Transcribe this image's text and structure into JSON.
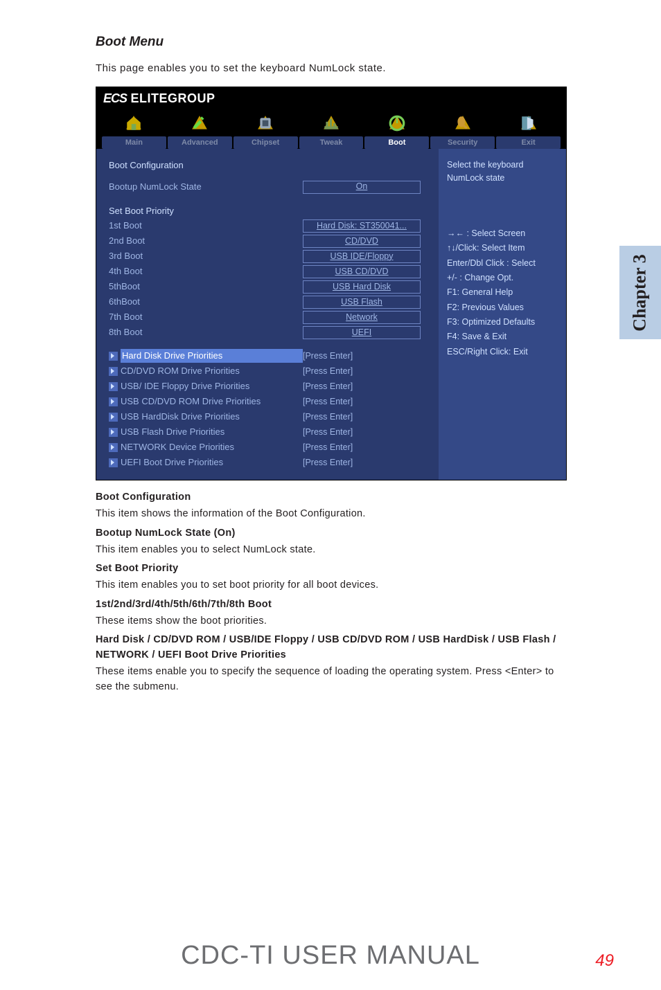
{
  "chapter_tab": "Chapter 3",
  "section": {
    "title": "Boot Menu",
    "intro": "This page enables you to set the keyboard NumLock state."
  },
  "bios": {
    "brand": "ELITEGROUP",
    "tabs": [
      "Main",
      "Advanced",
      "Chipset",
      "Tweak",
      "Boot",
      "Security",
      "Exit"
    ],
    "active_tab": "Boot",
    "left": {
      "boot_config_label": "Boot Configuration",
      "numlock_label": "Bootup NumLock State",
      "numlock_value": "On",
      "priority_header": "Set Boot Priority",
      "boots": [
        {
          "label": "1st Boot",
          "value": "Hard Disk: ST350041..."
        },
        {
          "label": "2nd Boot",
          "value": "CD/DVD"
        },
        {
          "label": "3rd Boot",
          "value": "USB IDE/Floppy"
        },
        {
          "label": "4th Boot",
          "value": "USB CD/DVD"
        },
        {
          "label": "5thBoot",
          "value": "USB Hard Disk"
        },
        {
          "label": "6thBoot",
          "value": "USB Flash"
        },
        {
          "label": "7th Boot",
          "value": "Network"
        },
        {
          "label": "8th Boot",
          "value": "UEFI"
        }
      ],
      "subs": [
        {
          "label": "Hard Disk Drive Priorities",
          "value": "[Press Enter]",
          "hl": true
        },
        {
          "label": "CD/DVD ROM Drive Priorities",
          "value": "[Press Enter]"
        },
        {
          "label": "USB/ IDE Floppy Drive Priorities",
          "value": "[Press Enter]"
        },
        {
          "label": "USB CD/DVD ROM Drive Priorities",
          "value": "[Press Enter]"
        },
        {
          "label": "USB HardDisk Drive Priorities",
          "value": "[Press Enter]"
        },
        {
          "label": "USB Flash Drive Priorities",
          "value": "[Press Enter]"
        },
        {
          "label": "NETWORK Device Priorities",
          "value": "[Press Enter]"
        },
        {
          "label": "UEFI Boot Drive Priorities",
          "value": "[Press Enter]"
        }
      ]
    },
    "right": {
      "context_help1": "Select the keyboard",
      "context_help2": "NumLock state",
      "keys": [
        "→←    : Select Screen",
        "↑↓/Click: Select Item",
        "Enter/Dbl Click : Select",
        "+/- : Change Opt.",
        "F1: General Help",
        "F2: Previous Values",
        "F3: Optimized Defaults",
        "F4: Save & Exit",
        "ESC/Right Click: Exit"
      ]
    }
  },
  "below": {
    "h1": "Boot Configuration",
    "p1": "This item shows the information of the Boot Configuration.",
    "h2": "Bootup NumLock State (On)",
    "p2": "This item enables you to select NumLock state.",
    "h3": "Set Boot Priority",
    "p3": "This item enables you to set boot priority for all boot devices.",
    "h4": "1st/2nd/3rd/4th/5th/6th/7th/8th Boot",
    "p4": "These items show the boot priorities.",
    "h5": "Hard Disk / CD/DVD ROM / USB/IDE Floppy / USB CD/DVD ROM / USB HardDisk / USB Flash / NETWORK / UEFI Boot Drive Priorities",
    "p5": "These items enable you to specify the sequence of loading the operating system. Press <Enter> to see the submenu."
  },
  "footer": {
    "title": "CDC-TI USER MANUAL",
    "page": "49"
  }
}
